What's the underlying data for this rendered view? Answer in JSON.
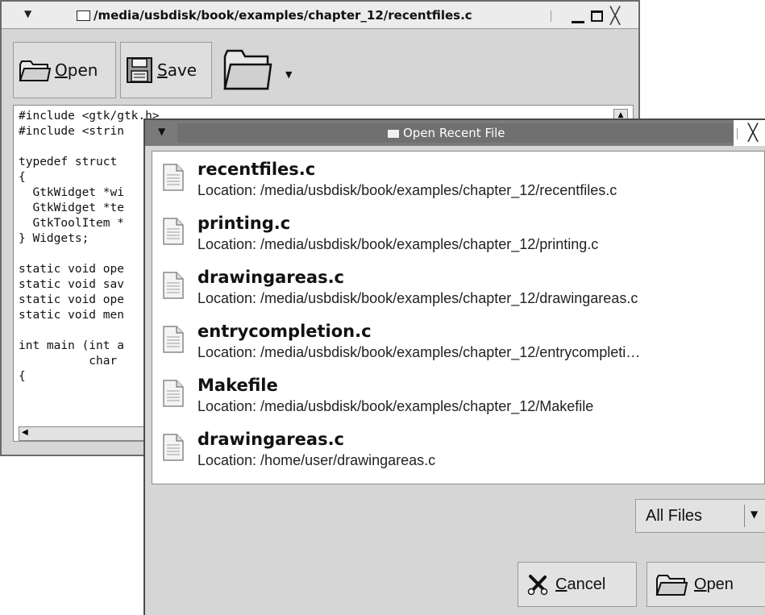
{
  "main_window": {
    "title": "/media/usbdisk/book/examples/chapter_12/recentfiles.c",
    "toolbar": {
      "open_mnemonic": "O",
      "open_rest": "pen",
      "save_mnemonic": "S",
      "save_rest": "ave"
    },
    "editor_text": "#include <gtk/gtk.h>\n#include <strin\n\ntypedef struct\n{\n  GtkWidget *wi\n  GtkWidget *te\n  GtkToolItem *\n} Widgets;\n\nstatic void ope\nstatic void sav\nstatic void ope\nstatic void men\n\nint main (int a\n          char\n{"
  },
  "dialog": {
    "title": "Open Recent File",
    "items": [
      {
        "name": "recentfiles.c",
        "location": "Location: /media/usbdisk/book/examples/chapter_12/recentfiles.c"
      },
      {
        "name": "printing.c",
        "location": "Location: /media/usbdisk/book/examples/chapter_12/printing.c"
      },
      {
        "name": "drawingareas.c",
        "location": "Location: /media/usbdisk/book/examples/chapter_12/drawingareas.c"
      },
      {
        "name": "entrycompletion.c",
        "location": "Location: /media/usbdisk/book/examples/chapter_12/entrycompleti…"
      },
      {
        "name": "Makefile",
        "location": "Location: /media/usbdisk/book/examples/chapter_12/Makefile"
      },
      {
        "name": "drawingareas.c",
        "location": "Location: /home/user/drawingareas.c"
      }
    ],
    "filter": {
      "selected": "All Files"
    },
    "cancel_mnemonic": "C",
    "cancel_rest": "ancel",
    "open_mnemonic": "O",
    "open_rest": "pen"
  }
}
